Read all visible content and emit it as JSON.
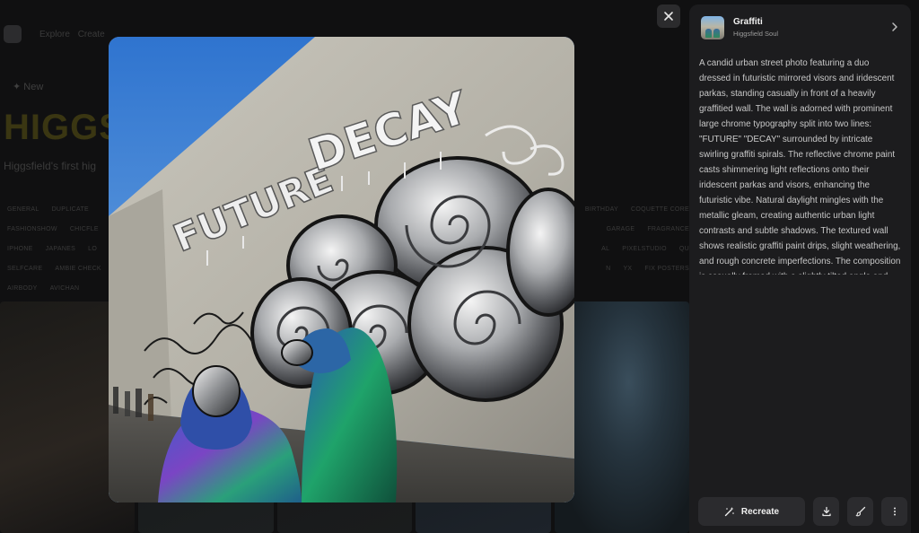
{
  "background": {
    "banner": "",
    "nav": [
      "Explore",
      "Create"
    ],
    "new_label": "New",
    "title": "HIGGS",
    "subtitle": "Higgsfield's first hig",
    "chip_rows": [
      [
        "GENERAL",
        "DUPLICATE",
        "",
        "",
        "",
        "",
        "",
        "",
        "",
        "",
        "",
        "",
        "",
        "",
        "",
        "",
        "",
        "",
        "",
        "",
        "",
        "",
        "",
        "",
        "",
        "",
        "",
        "",
        "",
        "",
        "",
        "",
        "",
        "",
        "",
        ""
      ],
      [
        "FASHIONSHOW",
        "CHICFLE"
      ],
      [
        "IPHONE",
        "JAPANES",
        "LO"
      ],
      [
        "SELFCARE",
        "AMBIE CHECK"
      ],
      [
        "AIRBODY",
        "AVICHAN"
      ]
    ],
    "chip_rows_right": [
      [
        "BIRTHDAY",
        "COQUETTE CORE"
      ],
      [
        "GARAGE",
        "FRAGRANCE"
      ],
      [
        "AL",
        "PIXELSTUDIO",
        "QU"
      ],
      [
        "N",
        "YX",
        "FIX POSTERS"
      ]
    ]
  },
  "modal": {
    "close_icon": "close-icon",
    "image_alt": "Two people in mirrored visors and iridescent parkas in front of a graffiti wall reading FUTURE DECAY",
    "image_text": {
      "line1": "FUTURE",
      "line2": "DECAY"
    }
  },
  "panel": {
    "title": "Graffiti",
    "subtitle": "Higgsfield Soul",
    "description": "A candid urban street photo featuring a duo dressed in futuristic mirrored visors and iridescent parkas, standing casually in front of a heavily graffitied wall. The wall is adorned with prominent large chrome typography split into two lines: \"FUTURE\" \"DECAY\" surrounded by intricate swirling graffiti spirals. The reflective chrome paint casts shimmering light reflections onto their iridescent parkas and visors, enhancing the futuristic vibe. Natural daylight mingles with the metallic gleam, creating authentic urban light contrasts and subtle shadows. The textured wall shows realistic graffiti paint drips, slight weathering, and rough concrete imperfections. The composition is casually framed with a slightly tilted angle and",
    "actions": {
      "recreate_label": "Recreate",
      "download_icon": "download-icon",
      "edit_icon": "brush-icon",
      "more_icon": "more-vertical-icon"
    }
  },
  "colors": {
    "panel_bg": "#1c1c1e",
    "button_bg": "#2b2b2e",
    "page_bg": "#0b0b0c"
  }
}
